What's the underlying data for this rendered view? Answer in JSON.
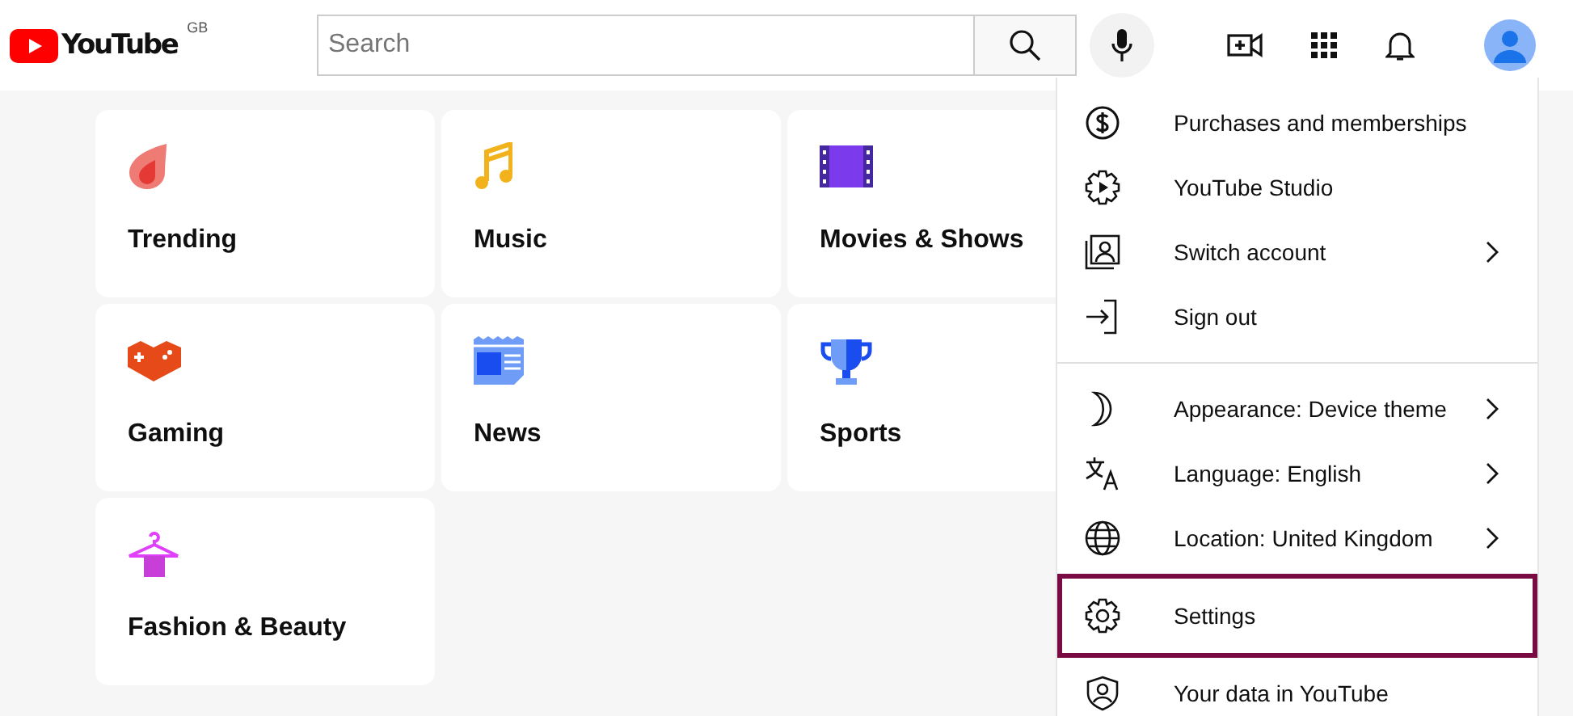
{
  "header": {
    "logo_text": "YouTube",
    "region": "GB",
    "search": {
      "placeholder": "Search"
    }
  },
  "categories": [
    {
      "label": "Trending"
    },
    {
      "label": "Music"
    },
    {
      "label": "Movies & Shows"
    },
    {
      "label": "Gaming"
    },
    {
      "label": "News"
    },
    {
      "label": "Sports"
    },
    {
      "label": "Fashion & Beauty"
    }
  ],
  "account_menu": {
    "sections": [
      [
        {
          "label": "Purchases and memberships",
          "submenu": false,
          "highlighted": false
        },
        {
          "label": "YouTube Studio",
          "submenu": false,
          "highlighted": false
        },
        {
          "label": "Switch account",
          "submenu": true,
          "highlighted": false
        },
        {
          "label": "Sign out",
          "submenu": false,
          "highlighted": false
        }
      ],
      [
        {
          "label": "Appearance: Device theme",
          "submenu": true,
          "highlighted": false
        },
        {
          "label": "Language: English",
          "submenu": true,
          "highlighted": false
        },
        {
          "label": "Location: United Kingdom",
          "submenu": true,
          "highlighted": false
        },
        {
          "label": "Settings",
          "submenu": false,
          "highlighted": true
        },
        {
          "label": "Your data in YouTube",
          "submenu": false,
          "highlighted": false
        }
      ]
    ]
  }
}
